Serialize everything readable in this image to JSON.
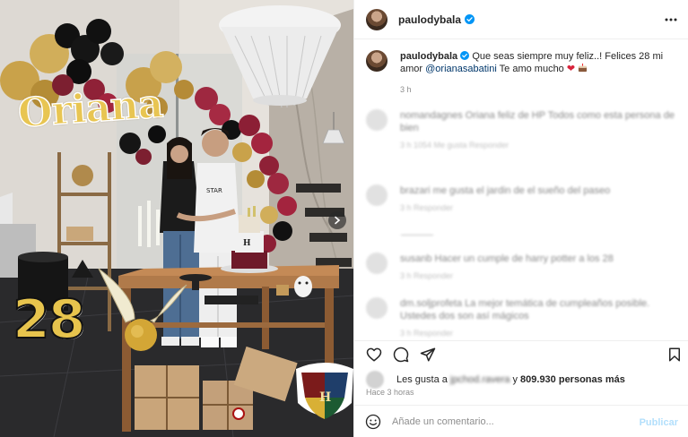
{
  "post": {
    "username": "paulodybala",
    "caption_text": "Que seas siempre muy feliz..! Felices 28 mi amor",
    "mention": "@orianasabatini",
    "caption_tail": "Te amo mucho",
    "caption_emojis": [
      "heart-emoji",
      "cake-emoji"
    ],
    "caption_time": "3 h",
    "photo": {
      "sign_text": "Oriana",
      "number_text": "28",
      "description_icons": [
        "balloons",
        "chandelier",
        "cake",
        "golden-snitch",
        "hogwarts-crest",
        "gift-boxes"
      ]
    },
    "colors": {
      "accent": "#0095f6",
      "link": "#00376b",
      "muted": "#8e8e8e",
      "publish_disabled": "#b2dffc",
      "heart": "#d8233b"
    }
  },
  "comments": [
    {
      "text": "nomandagnes Oriana feliz de HP Todos como esta persona de bien",
      "meta": "3 h   1054 Me gusta   Responder"
    },
    {
      "text": "brazari me gusta el jardin de el sueño del paseo",
      "meta": "3 h   Responder"
    },
    {
      "text": "",
      "meta": ""
    },
    {
      "text": "susanb Hacer un cumple de harry potter a los 28",
      "meta": "3 h   Responder"
    },
    {
      "text": "dm.soljprofeta La mejor temática de cumpleaños posible. Ustedes dos son así mágicos",
      "meta": "3 h   Responder"
    }
  ],
  "likes": {
    "prefix": "Les gusta a",
    "blurred_user": "jpchod.ravera",
    "connector": "y",
    "count_text": "809.930 personas más"
  },
  "time_ago": "Hace 3 horas",
  "comment_box": {
    "placeholder": "Añade un comentario...",
    "publish_label": "Publicar"
  },
  "icons": {
    "more": "more-icon",
    "verified": "verified-badge-icon",
    "like": "heart-icon",
    "comment": "comment-icon",
    "share": "share-icon",
    "save": "bookmark-icon",
    "emoji": "emoji-icon",
    "next": "chevron-right-icon"
  }
}
